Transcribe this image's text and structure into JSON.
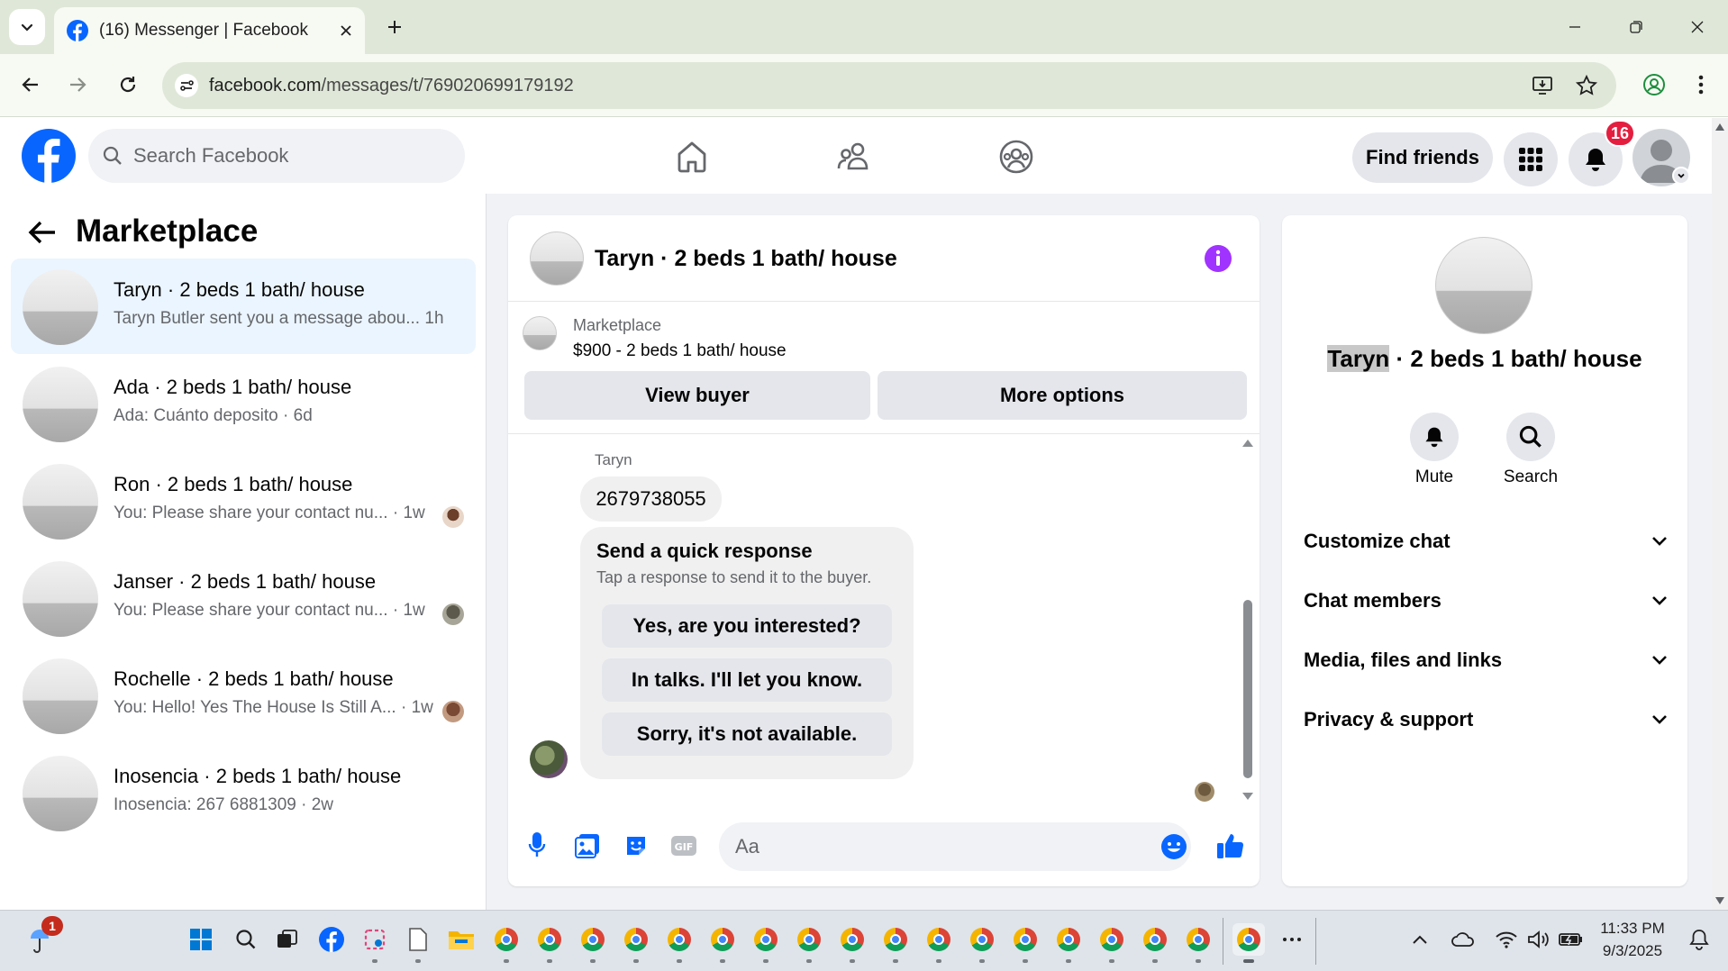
{
  "browser": {
    "tab_title": "(16) Messenger | Facebook",
    "url_domain": "facebook.com",
    "url_path": "/messages/t/769020699179192"
  },
  "header": {
    "search_placeholder": "Search Facebook",
    "find_friends": "Find friends",
    "notification_count": "16"
  },
  "sidebar": {
    "title": "Marketplace",
    "conversations": [
      {
        "name": "Taryn · 2 beds 1 bath/ house",
        "preview": "Taryn Butler sent you a message abou...",
        "time": "1h"
      },
      {
        "name": "Ada · 2 beds 1 bath/ house",
        "preview": "Ada: Cuánto deposito",
        "time": "6d"
      },
      {
        "name": "Ron · 2 beds 1 bath/ house",
        "preview": "You: Please share your contact nu...",
        "time": "1w"
      },
      {
        "name": "Janser · 2 beds 1 bath/ house",
        "preview": "You: Please share your contact nu...",
        "time": "1w"
      },
      {
        "name": "Rochelle · 2 beds 1 bath/ house",
        "preview": "You: Hello! Yes The House Is Still A...",
        "time": "1w"
      },
      {
        "name": "Inosencia · 2 beds 1 bath/ house",
        "preview": "Inosencia: 267 6881309",
        "time": "2w"
      }
    ]
  },
  "chat": {
    "title": "Taryn · 2 beds 1 bath/ house",
    "listing_label": "Marketplace",
    "listing_title": "$900 - 2 beds 1 bath/ house",
    "view_buyer": "View buyer",
    "more_options": "More options",
    "sender": "Taryn",
    "message": "2679738055",
    "quick_title": "Send a quick response",
    "quick_subtitle": "Tap a response to send it to the buyer.",
    "quick_responses": [
      "Yes, are you interested?",
      "In talks. I'll let you know.",
      "Sorry, it's not available."
    ],
    "composer_placeholder": "Aa"
  },
  "details": {
    "name_highlight": "Taryn",
    "name_rest": " · 2 beds 1 bath/ house",
    "mute": "Mute",
    "search": "Search",
    "sections": [
      "Customize chat",
      "Chat members",
      "Media, files and links",
      "Privacy & support"
    ]
  },
  "taskbar": {
    "clock_time": "11:33 PM",
    "clock_date": "9/3/2025",
    "badge": "1"
  },
  "colors": {
    "fb_blue": "#0866ff",
    "purple_accent": "#a033ff",
    "active_row": "#ebf5ff",
    "badge_red": "#e41e3f"
  }
}
